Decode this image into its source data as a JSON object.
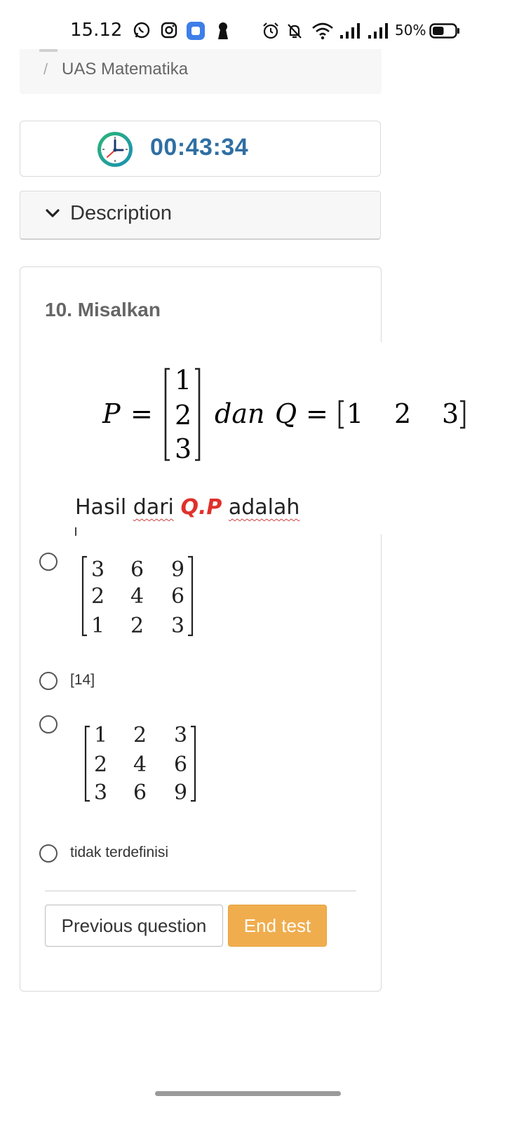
{
  "status_bar": {
    "time": "15.12",
    "battery_percent": "50%",
    "battery_level": 0.5,
    "icons": [
      "whatsapp-icon",
      "instagram-icon",
      "app-icon",
      "keyhole-icon",
      "alarm-icon",
      "mute-icon",
      "wifi-icon",
      "signal-icon",
      "signal-icon",
      "battery-icon"
    ]
  },
  "breadcrumb": {
    "separator": "/",
    "current": "UAS Matematika"
  },
  "timer": {
    "icon": "clock-icon",
    "value": "00:43:34",
    "color": "#2f6fa3"
  },
  "description": {
    "label": "Description",
    "icon": "chevron-down-icon"
  },
  "question": {
    "title": "10. Misalkan",
    "math": {
      "p_label": "P",
      "equals": "=",
      "p_values": [
        "1",
        "2",
        "3"
      ],
      "connector": "dan",
      "q_label": "Q",
      "q_values": [
        "1",
        "2",
        "3"
      ]
    },
    "prompt": {
      "before": "Hasil ",
      "w1": "dari",
      "space1": " ",
      "highlight": "Q.P",
      "space2": " ",
      "w2": "adalah"
    },
    "options": [
      {
        "type": "matrix",
        "rows": [
          [
            "3",
            "6",
            "9"
          ],
          [
            "2",
            "4",
            "6"
          ],
          [
            "1",
            "2",
            "3"
          ]
        ]
      },
      {
        "type": "text",
        "text": "[14]"
      },
      {
        "type": "matrix",
        "rows": [
          [
            "1",
            "2",
            "3"
          ],
          [
            "2",
            "4",
            "6"
          ],
          [
            "3",
            "6",
            "9"
          ]
        ]
      },
      {
        "type": "text",
        "text": "tidak terdefinisi"
      }
    ]
  },
  "buttons": {
    "previous": "Previous question",
    "end": "End test"
  },
  "colors": {
    "accent": "#f0ad4e",
    "timer": "#2f6fa3",
    "highlight": "#e0302b"
  }
}
